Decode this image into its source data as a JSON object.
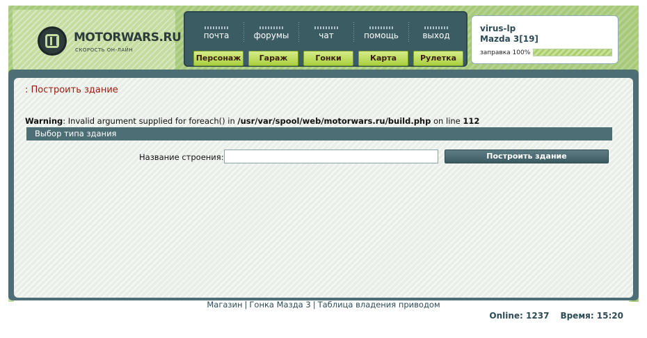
{
  "logo": {
    "title": "MOTORWARS.RU",
    "subtitle": "СКОРОСТЬ ОН-ЛАЙН"
  },
  "nav_top": [
    "почта",
    "форумы",
    "чат",
    "помощь",
    "выход"
  ],
  "nav_buttons": [
    "Персонаж",
    "Гараж",
    "Гонки",
    "Карта",
    "Рулетка"
  ],
  "user": {
    "name": "virus-lp",
    "car": "Mazda 3[19]",
    "fuel_label": "заправка 100%",
    "fuel_percent": 100
  },
  "page": {
    "title": ": Построить здание",
    "warning_prefix": "Warning",
    "warning_text": ": Invalid argument supplied for foreach() in ",
    "warning_path": "/usr/var/spool/web/motorwars.ru/build.php",
    "warning_online": " on line ",
    "warning_line": "112",
    "section_title": "Выбор типа здания",
    "form_label": "Название строения:",
    "input_value": "",
    "submit_label": "Построить здание"
  },
  "footer": {
    "links": [
      "Магазин",
      "Гонка Мазда 3",
      "Таблица владения приводом"
    ],
    "separator": "|",
    "online": "Online: 1237",
    "time": "Время: 15:20"
  },
  "colors": {
    "accent_green": "#a7c97a",
    "panel_teal": "#4e6e76",
    "title_red": "#9a1a0a"
  }
}
